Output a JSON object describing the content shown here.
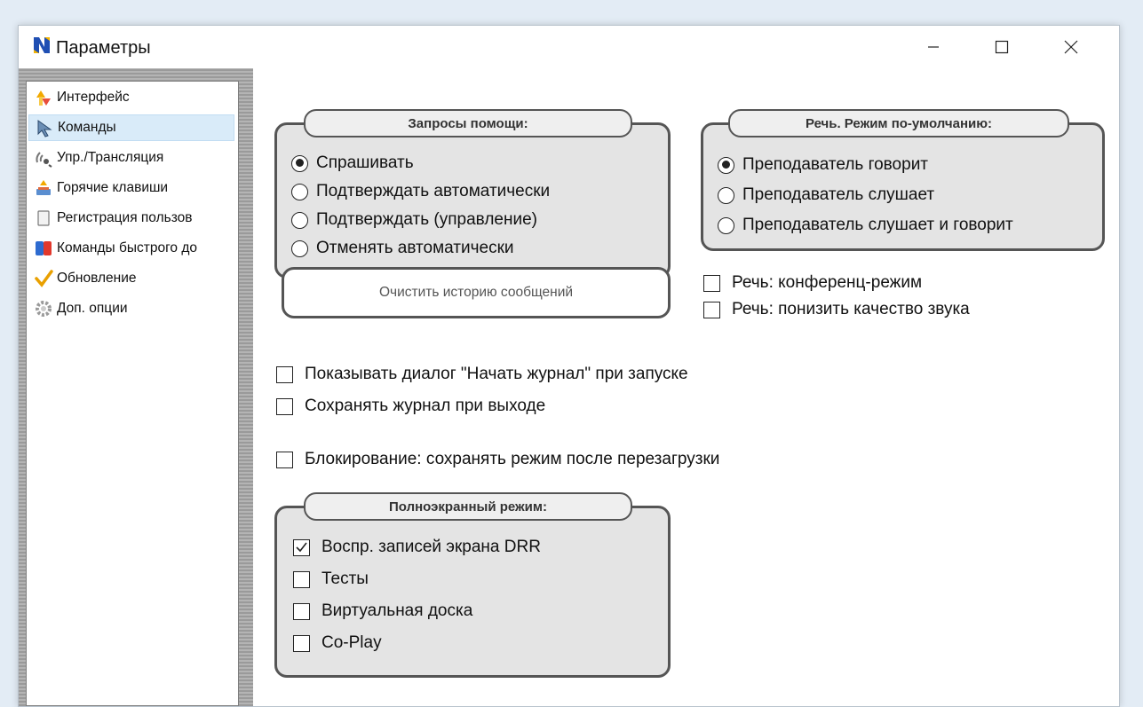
{
  "window": {
    "title": "Параметры",
    "icon": "app-n-icon"
  },
  "sidebar": {
    "items": [
      {
        "label": "Интерфейс",
        "icon": "interface-arrows-icon",
        "selected": false
      },
      {
        "label": "Команды",
        "icon": "cursor-arrow-icon",
        "selected": true
      },
      {
        "label": "Упр./Трансляция",
        "icon": "broadcast-icon",
        "selected": false
      },
      {
        "label": "Горячие клавиши",
        "icon": "hotkeys-icon",
        "selected": false
      },
      {
        "label": "Регистрация пользов",
        "icon": "registration-icon",
        "selected": false
      },
      {
        "label": "Команды быстрого до",
        "icon": "quick-commands-icon",
        "selected": false
      },
      {
        "label": "Обновление",
        "icon": "update-check-icon",
        "selected": false
      },
      {
        "label": "Доп. опции",
        "icon": "gear-icon",
        "selected": false
      }
    ]
  },
  "help_requests": {
    "title": "Запросы помощи:",
    "options": [
      {
        "label": "Спрашивать",
        "checked": true
      },
      {
        "label": "Подтверждать автоматически",
        "checked": false
      },
      {
        "label": "Подтверждать (управление)",
        "checked": false
      },
      {
        "label": "Отменять автоматически",
        "checked": false
      }
    ]
  },
  "speech_mode": {
    "title": "Речь. Режим по-умолчанию:",
    "options": [
      {
        "label": "Преподаватель говорит",
        "checked": true
      },
      {
        "label": "Преподаватель слушает",
        "checked": false
      },
      {
        "label": "Преподаватель слушает и говорит",
        "checked": false
      }
    ]
  },
  "speech_checks": [
    {
      "label": "Речь: конференц-режим",
      "checked": false
    },
    {
      "label": "Речь: понизить качество звука",
      "checked": false
    }
  ],
  "clear_history_button": "Очистить историю сообщений",
  "journal_checks": [
    {
      "label": "Показывать диалог \"Начать журнал\" при запуске",
      "checked": false
    },
    {
      "label": "Сохранять журнал при выходе",
      "checked": false
    }
  ],
  "lock_check": {
    "label": "Блокирование: сохранять режим после перезагрузки",
    "checked": false
  },
  "fullscreen": {
    "title": "Полноэкранный режим:",
    "options": [
      {
        "label": "Воспр. записей экрана DRR",
        "checked": true
      },
      {
        "label": "Тесты",
        "checked": false
      },
      {
        "label": "Виртуальная доска",
        "checked": false
      },
      {
        "label": "Co-Play",
        "checked": false
      }
    ]
  },
  "colors": {
    "group_bg": "#e4e4e4",
    "group_border": "#555555",
    "selection": "#d9ebf9"
  }
}
